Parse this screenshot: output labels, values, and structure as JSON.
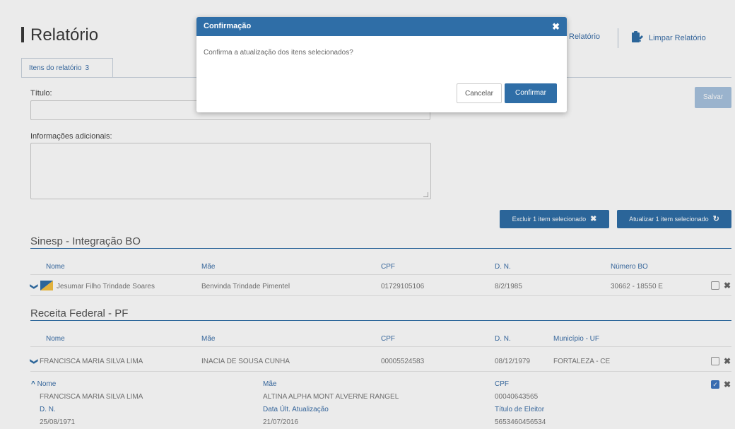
{
  "page": {
    "title": "Relatório"
  },
  "header_actions": {
    "relatorio_label": "Relatório",
    "limpar_label": "Limpar Relatório"
  },
  "tabs": [
    {
      "label": "Itens do relatório",
      "count": "3"
    }
  ],
  "form": {
    "titulo_label": "Título:",
    "info_label": "Informações adicionais:",
    "salvar_label": "Salvar"
  },
  "actions": {
    "excluir_label": "Excluir 1 item selecionado",
    "atualizar_label": "Atualizar 1 item selecionado"
  },
  "sinesp": {
    "title": "Sinesp - Integração BO",
    "columns": [
      "Nome",
      "Mãe",
      "CPF",
      "D. N.",
      "Número BO"
    ],
    "rows": [
      {
        "nome": "Jesumar Filho Trindade Soares",
        "mae": "Benvinda Trindade Pimentel",
        "cpf": "01729105106",
        "dn": "8/2/1985",
        "bo": "30662 - 18550 E"
      }
    ]
  },
  "receita": {
    "title": "Receita Federal - PF",
    "columns": [
      "Nome",
      "Mãe",
      "CPF",
      "D. N.",
      "Município - UF"
    ],
    "rows": [
      {
        "nome": "FRANCISCA MARIA SILVA LIMA",
        "mae": "INACIA DE SOUSA CUNHA",
        "cpf": "00005524583",
        "dn": "08/12/1979",
        "municipio": "FORTALEZA - CE"
      }
    ],
    "detail": {
      "nome_h": "Nome",
      "nome": "FRANCISCA MARIA SILVA LIMA",
      "mae_h": "Mãe",
      "mae": "ALTINA ALPHA MONT ALVERNE RANGEL",
      "cpf_h": "CPF",
      "cpf": "00040643565",
      "dn_h": "D. N.",
      "dn": "25/08/1971",
      "data_h": "Data Últ. Atualização",
      "data": "21/07/2016",
      "titulo_h": "Título de Eleitor",
      "titulo": "5653460456534"
    }
  },
  "modal": {
    "title": "Confirmação",
    "close": "✖",
    "message": "Confirma a atualização dos itens selecionados?",
    "cancel_label": "Cancelar",
    "confirm_label": "Confirmar"
  },
  "colors": {
    "primary": "#2f6ea7",
    "link": "#3a6ea8",
    "salvar": "#a8c3df"
  }
}
